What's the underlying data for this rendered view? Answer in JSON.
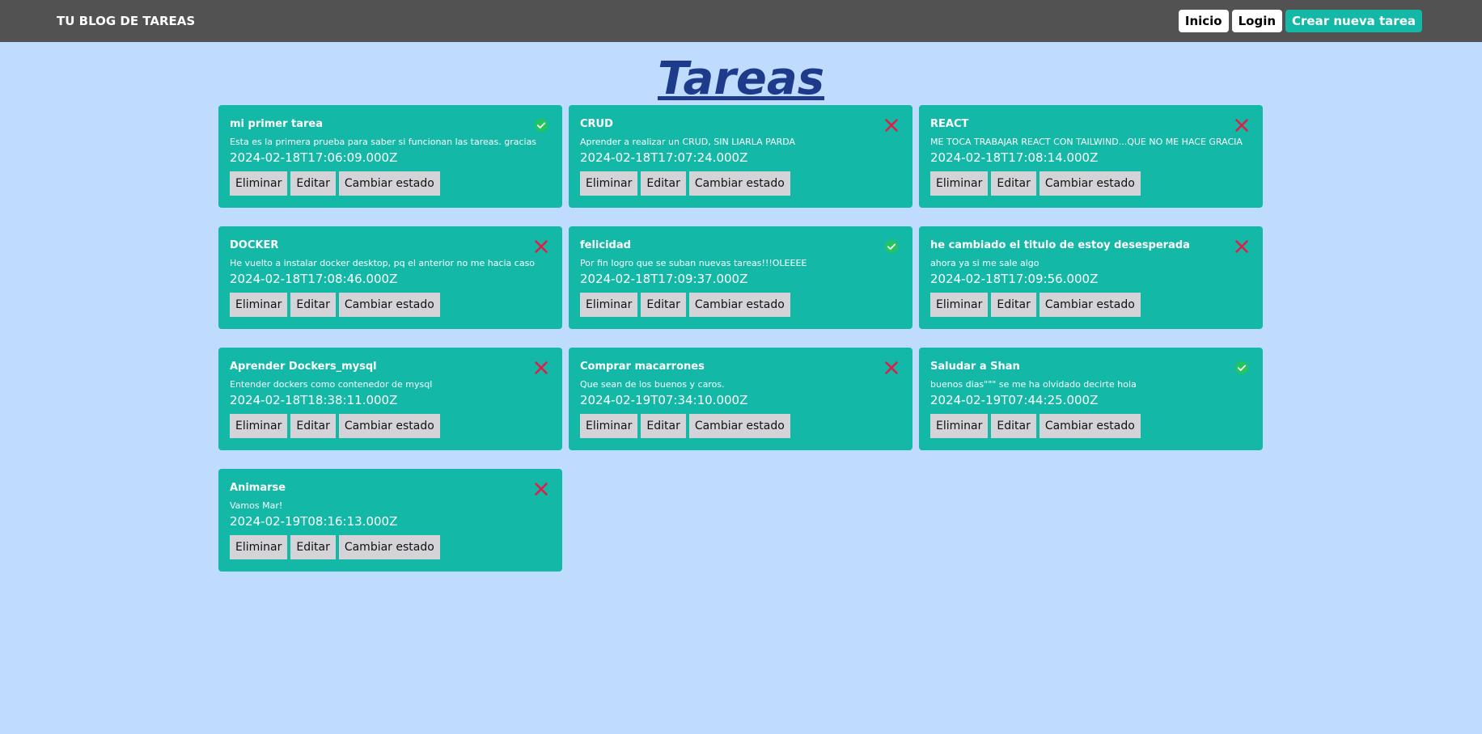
{
  "nav": {
    "brand": "TU BLOG DE TAREAS",
    "inicio": "Inicio",
    "login": "Login",
    "crear": "Crear nueva tarea"
  },
  "page_title": "Tareas",
  "actions": {
    "eliminar": "Eliminar",
    "editar": "Editar",
    "cambiar": "Cambiar estado"
  },
  "colors": {
    "nav_bg": "#525252",
    "page_bg": "#bfdbfe",
    "card_bg": "#14b8a6",
    "title_color": "#1e3a8a",
    "done_color": "#22c55e",
    "pending_color": "#e11d48"
  },
  "tasks": [
    {
      "title": "mi primer tarea",
      "description": "Esta es la primera prueba para saber si funcionan las tareas. gracias",
      "date": "2024-02-18T17:06:09.000Z",
      "status_icon": "check-circle-icon"
    },
    {
      "title": "CRUD",
      "description": "Aprender a realizar un CRUD, SIN LIARLA PARDA",
      "date": "2024-02-18T17:07:24.000Z",
      "status_icon": "x-mark-icon"
    },
    {
      "title": "REACT",
      "description": "ME TOCA TRABAJAR REACT CON TAILWIND...QUE NO ME HACE GRACIA",
      "date": "2024-02-18T17:08:14.000Z",
      "status_icon": "x-mark-icon"
    },
    {
      "title": "DOCKER",
      "description": "He vuelto a instalar docker desktop, pq el anterior no me hacia caso",
      "date": "2024-02-18T17:08:46.000Z",
      "status_icon": "x-mark-icon"
    },
    {
      "title": "felicidad",
      "description": "Por fin logro que se suban nuevas tareas!!!OLEEEE",
      "date": "2024-02-18T17:09:37.000Z",
      "status_icon": "check-circle-icon"
    },
    {
      "title": "he cambiado el titulo de estoy desesperada",
      "description": "ahora ya si me sale algo",
      "date": "2024-02-18T17:09:56.000Z",
      "status_icon": "x-mark-icon"
    },
    {
      "title": "Aprender Dockers_mysql",
      "description": "Entender dockers como contenedor de mysql",
      "date": "2024-02-18T18:38:11.000Z",
      "status_icon": "x-mark-icon"
    },
    {
      "title": "Comprar macarrones",
      "description": "Que sean de los buenos y caros.",
      "date": "2024-02-19T07:34:10.000Z",
      "status_icon": "x-mark-icon"
    },
    {
      "title": "Saludar a Shan",
      "description": "buenos dias\"\"\" se me ha olvidado decirte hola",
      "date": "2024-02-19T07:44:25.000Z",
      "status_icon": "check-circle-icon"
    },
    {
      "title": "Animarse",
      "description": "Vamos Mar!",
      "date": "2024-02-19T08:16:13.000Z",
      "status_icon": "x-mark-icon"
    }
  ]
}
